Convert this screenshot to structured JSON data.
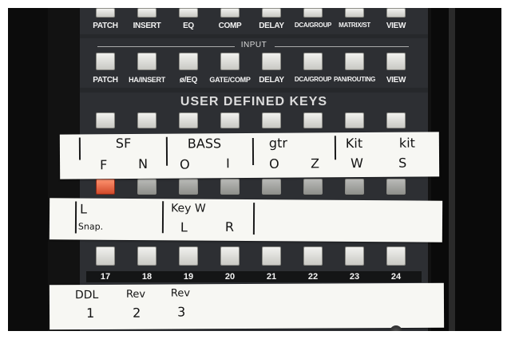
{
  "top_row": {
    "labels": [
      "PATCH",
      "INSERT",
      "EQ",
      "COMP",
      "DELAY",
      "DCA/GROUP",
      "MATRIX/ST",
      "VIEW"
    ]
  },
  "input_section": {
    "title": "INPUT",
    "labels": [
      "PATCH",
      "HA/INSERT",
      "ø/EQ",
      "GATE/COMP",
      "DELAY",
      "DCA/GROUP",
      "PAN/ROUTING",
      "VIEW"
    ]
  },
  "user_defined_keys": {
    "title": "USER DEFINED KEYS",
    "numbers": [
      "17",
      "18",
      "19",
      "20",
      "21",
      "22",
      "23",
      "24"
    ]
  },
  "tape_labels": {
    "row1": {
      "top": [
        "SF",
        "BASS",
        "gtr",
        "Kit",
        "kit"
      ],
      "bottom": [
        "F",
        "N",
        "O",
        "I",
        "O",
        "Z",
        "W",
        "S"
      ]
    },
    "row2": {
      "top": [
        "L",
        "Key W"
      ],
      "bottom": [
        "Snap.",
        "L",
        "R"
      ]
    },
    "row3": {
      "top": [
        "DDL",
        "Rev",
        "Rev"
      ],
      "bottom": [
        "1",
        "2",
        "3"
      ]
    }
  },
  "colors": {
    "panel": "#2d2f33",
    "key": "#e8e8e4",
    "lit_key": "#f06a47",
    "tape": "#f7f7f3"
  }
}
